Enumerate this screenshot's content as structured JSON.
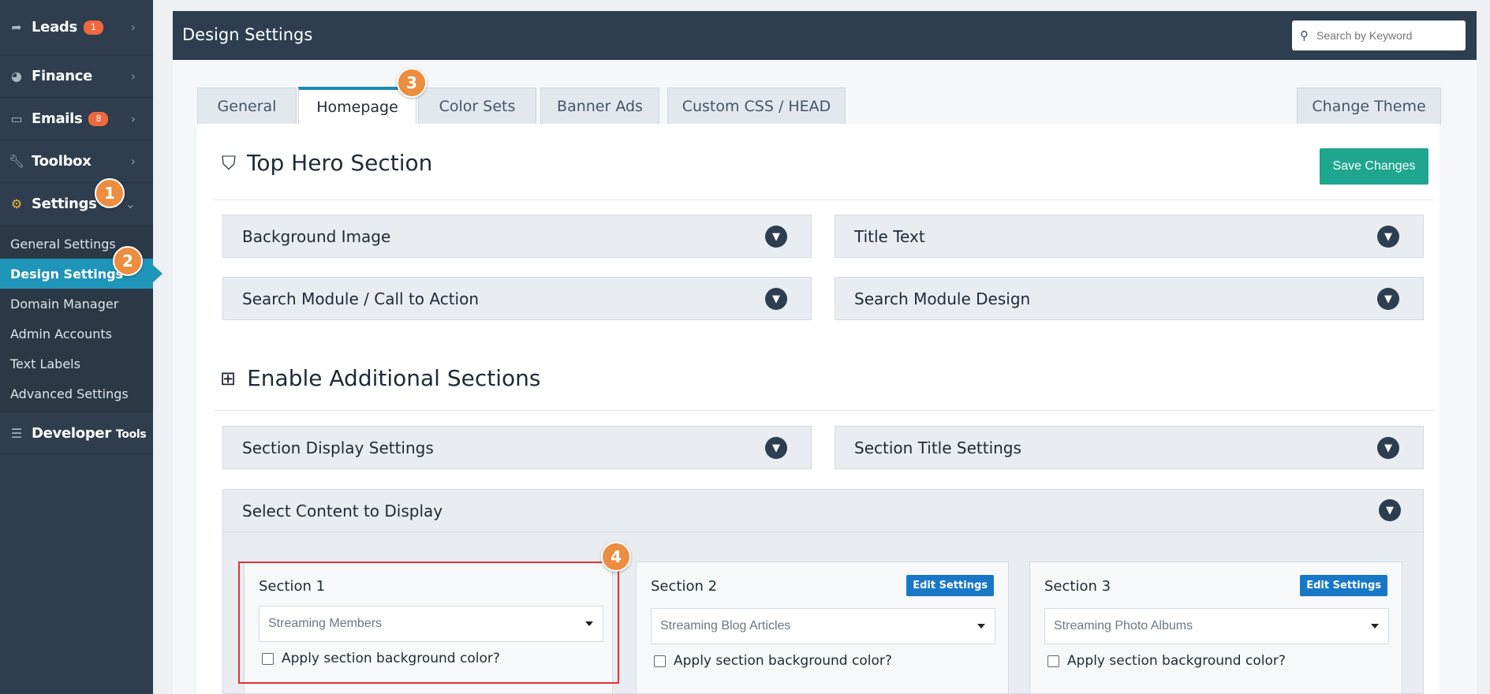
{
  "sidebar": {
    "items": [
      {
        "label": "Leads",
        "icon": "share-arrow-icon",
        "badge": "1"
      },
      {
        "label": "Finance",
        "icon": "pie-chart-icon"
      },
      {
        "label": "Emails",
        "icon": "inbox-icon",
        "badge": "8"
      },
      {
        "label": "Toolbox",
        "icon": "wrench-icon"
      },
      {
        "label": "Settings",
        "icon": "gear-icon"
      }
    ],
    "subitems": [
      {
        "label": "General Settings"
      },
      {
        "label": "Design Settings",
        "active": true
      },
      {
        "label": "Domain Manager"
      },
      {
        "label": "Admin Accounts"
      },
      {
        "label": "Text Labels"
      },
      {
        "label": "Advanced Settings"
      }
    ],
    "developer": {
      "label": "Developer",
      "small": "Tools",
      "icon": "sliders-icon"
    }
  },
  "steps": [
    "1",
    "2",
    "3",
    "4"
  ],
  "header": {
    "title": "Design Settings",
    "search_placeholder": "Search by Keyword"
  },
  "tabs": [
    "General",
    "Homepage",
    "Color Sets",
    "Banner Ads",
    "Custom CSS / HEAD",
    "Change Theme"
  ],
  "active_tab": "Homepage",
  "hero": {
    "title": "Top Hero Section",
    "save_label": "Save Changes",
    "accordions": [
      "Background Image",
      "Title Text",
      "Search Module / Call to Action",
      "Search Module Design"
    ]
  },
  "additional": {
    "title": "Enable Additional Sections",
    "accordions": [
      "Section Display Settings",
      "Section Title Settings"
    ],
    "content_title": "Select Content to Display",
    "sections": [
      {
        "title": "Section 1",
        "value": "Streaming Members",
        "checkbox": "Apply section background color?"
      },
      {
        "title": "Section 2",
        "value": "Streaming Blog Articles",
        "checkbox": "Apply section background color?",
        "edit": "Edit Settings"
      },
      {
        "title": "Section 3",
        "value": "Streaming Photo Albums",
        "checkbox": "Apply section background color?",
        "edit": "Edit Settings"
      }
    ]
  },
  "colors": {
    "sidebar": "#2f3e4e",
    "header": "#2d3e50",
    "accent": "#1f95b9",
    "save": "#1ea68f",
    "edit": "#1878c8",
    "badge": "#f0683e",
    "step": "#ec8d3f",
    "highlight": "#e23232"
  }
}
